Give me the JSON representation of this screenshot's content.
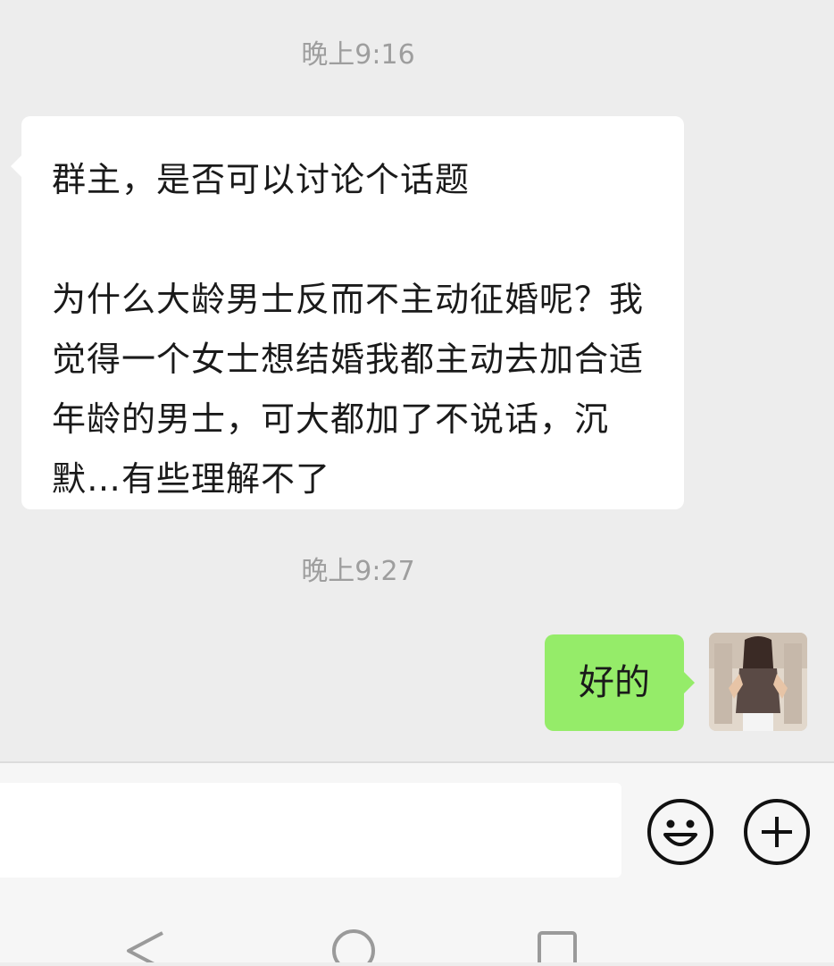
{
  "chat": {
    "timestamp_1": "晚上9:16",
    "incoming_message": {
      "line1": "群主，是否可以讨论个话题",
      "line2": "为什么大龄男士反而不主动征婚呢？我觉得一个女士想结婚我都主动去加合适年龄的男士，可大都加了不说话，沉默…有些理解不了"
    },
    "timestamp_2": "晚上9:27",
    "outgoing_message": "好的"
  },
  "input_bar": {
    "text_value": "",
    "emoji_icon": "smiley-icon",
    "plus_icon": "plus-icon"
  },
  "nav_bar": {
    "icons": [
      "back-triangle-icon",
      "home-circle-icon",
      "recent-square-icon"
    ]
  },
  "colors": {
    "background": "#ededed",
    "incoming_bubble": "#ffffff",
    "outgoing_bubble": "#95ec69",
    "timestamp_text": "#9e9e9e"
  }
}
